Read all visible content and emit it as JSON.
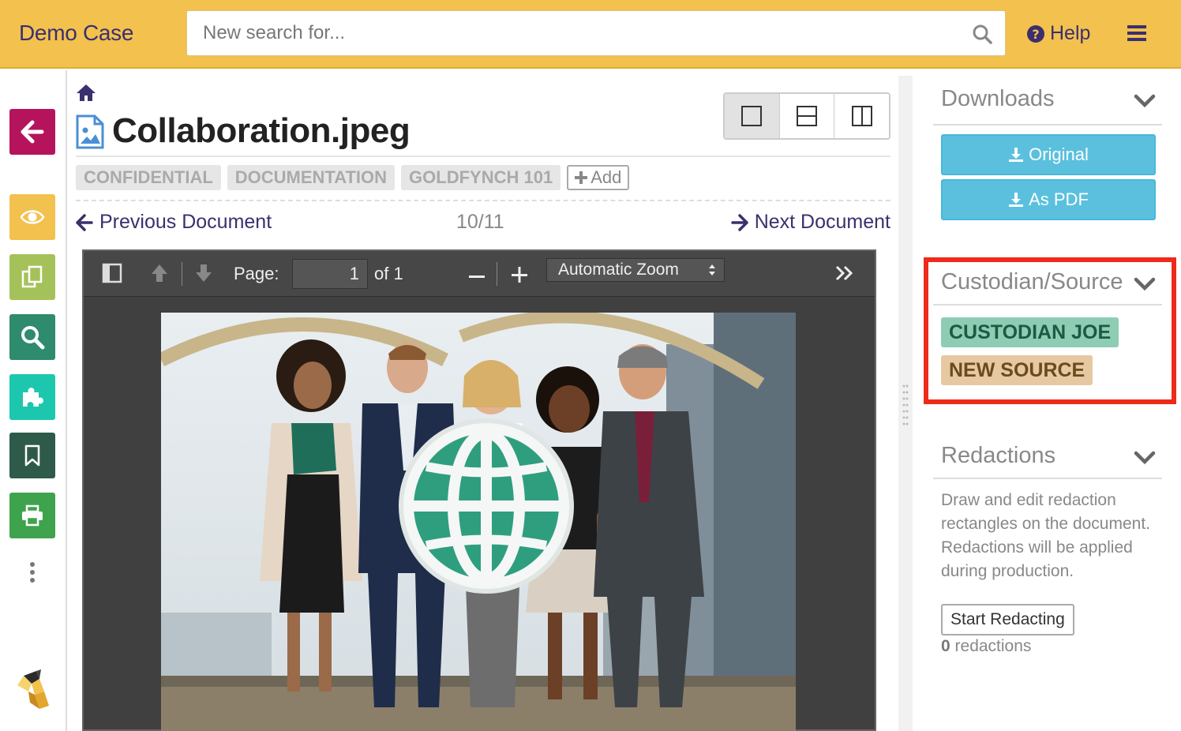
{
  "header": {
    "brand": "Demo Case",
    "search_placeholder": "New search for...",
    "help_label": "Help"
  },
  "document": {
    "title": "Collaboration.jpeg",
    "tags": [
      "CONFIDENTIAL",
      "DOCUMENTATION",
      "GOLDFYNCH 101"
    ],
    "add_label": "Add",
    "prev_label": "Previous Document",
    "position": "10/11",
    "next_label": "Next Document"
  },
  "viewer": {
    "page_label": "Page:",
    "page_value": "1",
    "page_of": "of 1",
    "zoom": "Automatic Zoom"
  },
  "sidebar": {
    "downloads": {
      "title": "Downloads",
      "original_label": "Original",
      "pdf_label": "As PDF"
    },
    "custodian": {
      "title": "Custodian/Source",
      "custodian": "CUSTODIAN JOE",
      "source": "NEW SOURCE"
    },
    "redactions": {
      "title": "Redactions",
      "description": "Draw and edit redaction rectangles on the document. Redactions will be applied during production.",
      "start_label": "Start Redacting",
      "count": "0",
      "count_suffix": "redactions"
    }
  },
  "colors": {
    "header_bg": "#f2c14e",
    "brand_text": "#3c2f6e",
    "download_btn": "#5bc0de",
    "highlight": "#ee2a1a",
    "custodian_badge": "#8fccb4",
    "source_badge": "#e6c9a2"
  },
  "icons": [
    "search-icon",
    "question-circle-icon",
    "hamburger-menu-icon",
    "arrow-left-icon",
    "eye-icon",
    "copy-icon",
    "search-icon",
    "puzzle-icon",
    "bookmark-icon",
    "print-icon",
    "home-icon",
    "image-file-icon",
    "download-icon",
    "chevron-down-icon"
  ]
}
